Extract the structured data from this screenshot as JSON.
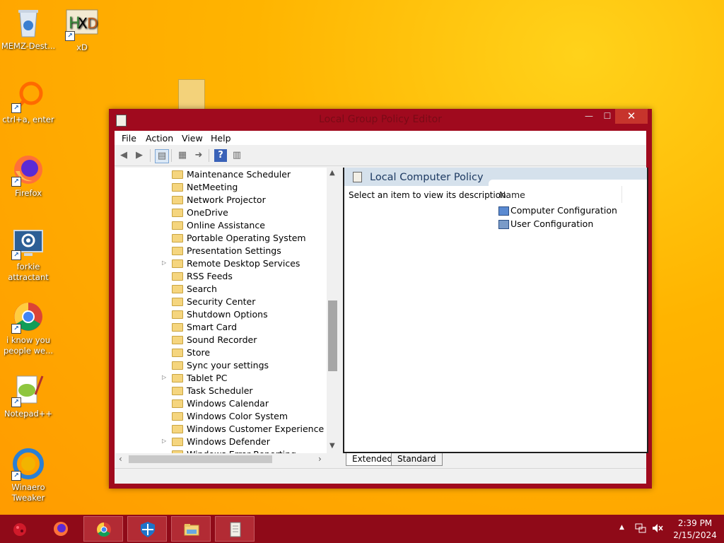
{
  "desktop": {
    "icons": [
      {
        "label": "MEMZ-Dest..."
      },
      {
        "label": "xD"
      },
      {
        "label": "ctrl+a, enter"
      },
      {
        "label": "Firefox"
      },
      {
        "label": "forkie attractant"
      },
      {
        "label": "i know you people we..."
      },
      {
        "label": "Notepad++"
      },
      {
        "label": "Winaero Tweaker"
      }
    ]
  },
  "window": {
    "title": "Local Group Policy Editor",
    "controls": {
      "minimize": "—",
      "maximize": "☐",
      "close": "✕"
    },
    "menu": [
      "File",
      "Action",
      "View",
      "Help"
    ],
    "tree_items": [
      {
        "label": "Maintenance Scheduler",
        "expandable": false
      },
      {
        "label": "NetMeeting",
        "expandable": false
      },
      {
        "label": "Network Projector",
        "expandable": false
      },
      {
        "label": "OneDrive",
        "expandable": false
      },
      {
        "label": "Online Assistance",
        "expandable": false
      },
      {
        "label": "Portable Operating System",
        "expandable": false
      },
      {
        "label": "Presentation Settings",
        "expandable": false
      },
      {
        "label": "Remote Desktop Services",
        "expandable": true
      },
      {
        "label": "RSS Feeds",
        "expandable": false
      },
      {
        "label": "Search",
        "expandable": false
      },
      {
        "label": "Security Center",
        "expandable": false
      },
      {
        "label": "Shutdown Options",
        "expandable": false
      },
      {
        "label": "Smart Card",
        "expandable": false
      },
      {
        "label": "Sound Recorder",
        "expandable": false
      },
      {
        "label": "Store",
        "expandable": false
      },
      {
        "label": "Sync your settings",
        "expandable": false
      },
      {
        "label": "Tablet PC",
        "expandable": true
      },
      {
        "label": "Task Scheduler",
        "expandable": false
      },
      {
        "label": "Windows Calendar",
        "expandable": false
      },
      {
        "label": "Windows Color System",
        "expandable": false
      },
      {
        "label": "Windows Customer Experience Impro",
        "expandable": false
      },
      {
        "label": "Windows Defender",
        "expandable": true
      },
      {
        "label": "Windows Error Reporting",
        "expandable": false
      }
    ],
    "right_pane": {
      "title": "Local Computer Policy",
      "description": "Select an item to view its description.",
      "column_name": "Name",
      "items": [
        "Computer Configuration",
        "User Configuration"
      ]
    },
    "tabs": [
      "Extended",
      "Standard"
    ]
  },
  "taskbar": {
    "time": "2:39 PM",
    "date": "2/15/2024"
  },
  "colors": {
    "window_frame": "#a00a1e",
    "taskbar": "#8f0a18",
    "close_button": "#c7342c",
    "desktop": "#ffb400"
  }
}
